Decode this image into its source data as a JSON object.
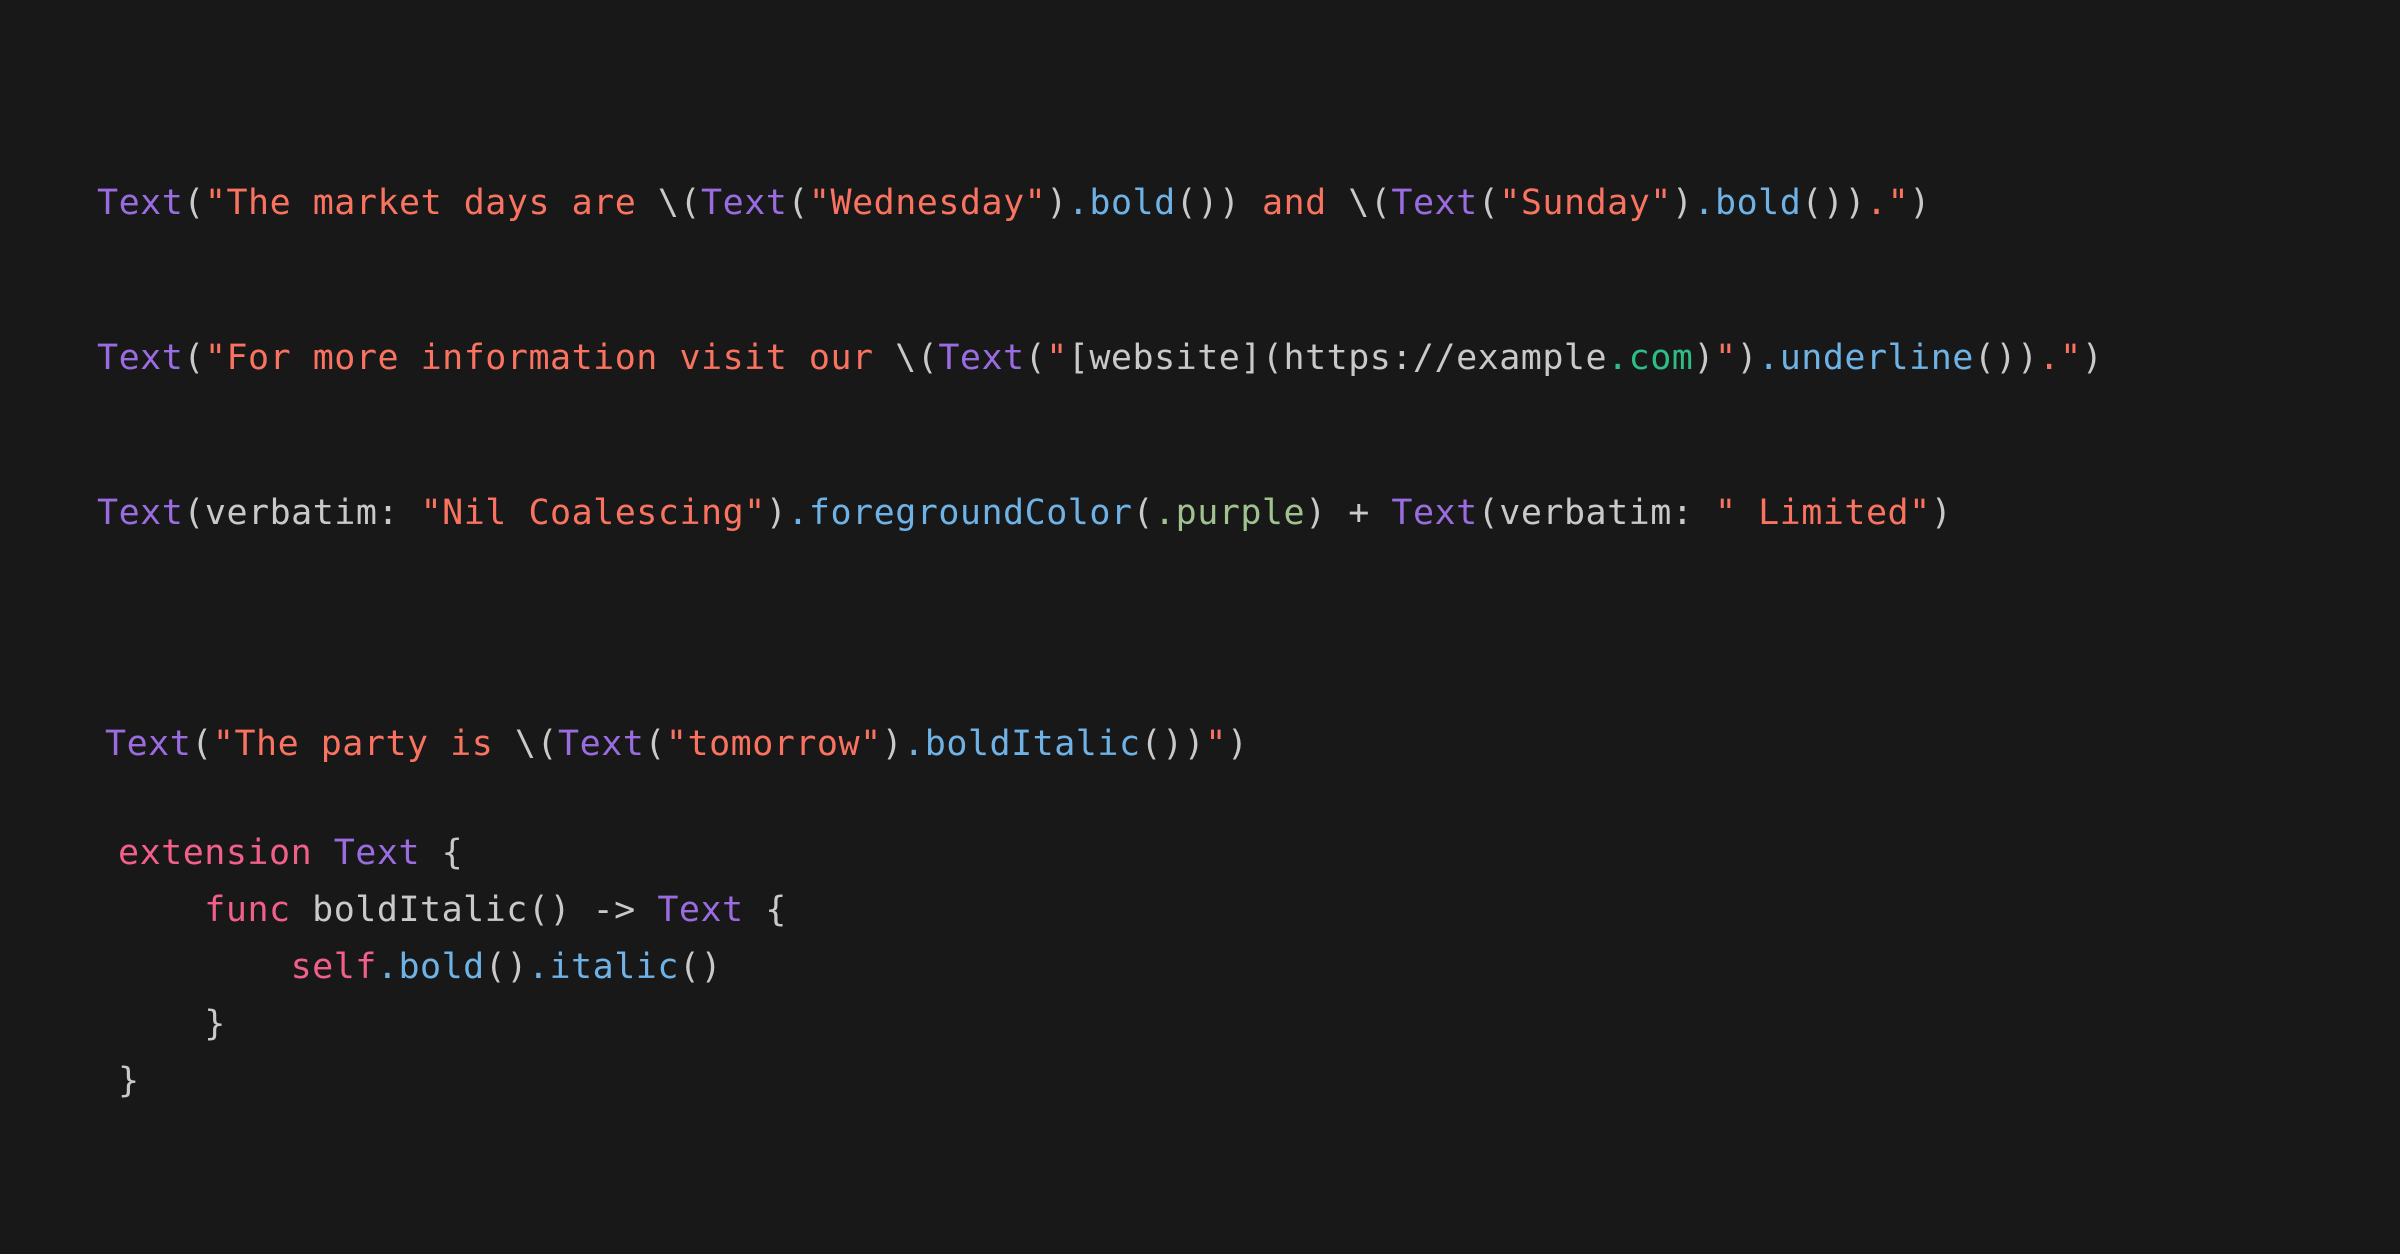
{
  "theme": {
    "background": "#181818",
    "plain": "#c9c9c9",
    "type": "#9a6ce0",
    "string": "#fa7360",
    "method": "#6fb2e6",
    "keyword": "#f2608a",
    "enum_case": "#a0c28f",
    "link_domain": "#2ebd84"
  },
  "language": "swift",
  "snippets": [
    {
      "id": "market-days",
      "text": "Text(\"The market days are \\(Text(\"Wednesday\").bold()) and \\(Text(\"Sunday\").bold()).\")",
      "tokens": [
        {
          "t": "Text",
          "c": "type"
        },
        {
          "t": "(",
          "c": "punct"
        },
        {
          "t": "\"The market days are ",
          "c": "string"
        },
        {
          "t": "\\(",
          "c": "plain"
        },
        {
          "t": "Text",
          "c": "type"
        },
        {
          "t": "(",
          "c": "punct"
        },
        {
          "t": "\"Wednesday\"",
          "c": "string"
        },
        {
          "t": ")",
          "c": "punct"
        },
        {
          "t": ".",
          "c": "method"
        },
        {
          "t": "bold",
          "c": "method"
        },
        {
          "t": "())",
          "c": "punct"
        },
        {
          "t": " and ",
          "c": "string"
        },
        {
          "t": "\\(",
          "c": "plain"
        },
        {
          "t": "Text",
          "c": "type"
        },
        {
          "t": "(",
          "c": "punct"
        },
        {
          "t": "\"Sunday\"",
          "c": "string"
        },
        {
          "t": ")",
          "c": "punct"
        },
        {
          "t": ".",
          "c": "method"
        },
        {
          "t": "bold",
          "c": "method"
        },
        {
          "t": "())",
          "c": "punct"
        },
        {
          "t": ".\"",
          "c": "string"
        },
        {
          "t": ")",
          "c": "punct"
        }
      ]
    },
    {
      "id": "website-link",
      "text": "Text(\"For more information visit our \\(Text(\"[website](https://example.com\").underline()).\")",
      "tokens": [
        {
          "t": "Text",
          "c": "type"
        },
        {
          "t": "(",
          "c": "punct"
        },
        {
          "t": "\"For more information visit our ",
          "c": "string"
        },
        {
          "t": "\\(",
          "c": "plain"
        },
        {
          "t": "Text",
          "c": "type"
        },
        {
          "t": "(",
          "c": "punct"
        },
        {
          "t": "\"",
          "c": "string"
        },
        {
          "t": "[website](https://example",
          "c": "plain"
        },
        {
          "t": ".com",
          "c": "link"
        },
        {
          "t": ")",
          "c": "plain"
        },
        {
          "t": "\"",
          "c": "string"
        },
        {
          "t": ")",
          "c": "punct"
        },
        {
          "t": ".",
          "c": "method"
        },
        {
          "t": "underline",
          "c": "method"
        },
        {
          "t": "())",
          "c": "punct"
        },
        {
          "t": ".\"",
          "c": "string"
        },
        {
          "t": ")",
          "c": "punct"
        }
      ]
    },
    {
      "id": "nil-coalescing",
      "text": "Text(verbatim: \"Nil Coalescing\").foregroundColor(.purple) + Text(verbatim: \" Limited\")",
      "tokens": [
        {
          "t": "Text",
          "c": "type"
        },
        {
          "t": "(",
          "c": "punct"
        },
        {
          "t": "verbatim: ",
          "c": "plain"
        },
        {
          "t": "\"Nil Coalescing\"",
          "c": "string"
        },
        {
          "t": ")",
          "c": "punct"
        },
        {
          "t": ".",
          "c": "method"
        },
        {
          "t": "foregroundColor",
          "c": "method"
        },
        {
          "t": "(",
          "c": "punct"
        },
        {
          "t": ".purple",
          "c": "enum"
        },
        {
          "t": ")",
          "c": "punct"
        },
        {
          "t": " + ",
          "c": "plain"
        },
        {
          "t": "Text",
          "c": "type"
        },
        {
          "t": "(",
          "c": "punct"
        },
        {
          "t": "verbatim: ",
          "c": "plain"
        },
        {
          "t": "\" Limited\"",
          "c": "string"
        },
        {
          "t": ")",
          "c": "punct"
        }
      ]
    },
    {
      "id": "party-tomorrow",
      "text": "Text(\"The party is \\(Text(\"tomorrow\").boldItalic())\")",
      "tokens": [
        {
          "t": "Text",
          "c": "type"
        },
        {
          "t": "(",
          "c": "punct"
        },
        {
          "t": "\"The party is ",
          "c": "string"
        },
        {
          "t": "\\(",
          "c": "plain"
        },
        {
          "t": "Text",
          "c": "type"
        },
        {
          "t": "(",
          "c": "punct"
        },
        {
          "t": "\"tomorrow\"",
          "c": "string"
        },
        {
          "t": ")",
          "c": "punct"
        },
        {
          "t": ".",
          "c": "method"
        },
        {
          "t": "boldItalic",
          "c": "method"
        },
        {
          "t": "())",
          "c": "punct"
        },
        {
          "t": "\"",
          "c": "string"
        },
        {
          "t": ")",
          "c": "punct"
        }
      ]
    },
    {
      "id": "extension-open",
      "text": "extension Text {",
      "tokens": [
        {
          "t": "extension",
          "c": "keyword"
        },
        {
          "t": " ",
          "c": "plain"
        },
        {
          "t": "Text",
          "c": "type"
        },
        {
          "t": " {",
          "c": "punct"
        }
      ]
    },
    {
      "id": "func-bolditalic",
      "text": "    func boldItalic() -> Text {",
      "tokens": [
        {
          "t": "    ",
          "c": "plain"
        },
        {
          "t": "func",
          "c": "keyword"
        },
        {
          "t": " boldItalic() -> ",
          "c": "plain"
        },
        {
          "t": "Text",
          "c": "type"
        },
        {
          "t": " {",
          "c": "punct"
        }
      ]
    },
    {
      "id": "self-bold-italic",
      "text": "        self.bold().italic()",
      "tokens": [
        {
          "t": "        ",
          "c": "plain"
        },
        {
          "t": "self",
          "c": "self"
        },
        {
          "t": ".",
          "c": "method"
        },
        {
          "t": "bold",
          "c": "method"
        },
        {
          "t": "()",
          "c": "punct"
        },
        {
          "t": ".",
          "c": "method"
        },
        {
          "t": "italic",
          "c": "method"
        },
        {
          "t": "()",
          "c": "punct"
        }
      ]
    },
    {
      "id": "func-close",
      "text": "    }",
      "tokens": [
        {
          "t": "    }",
          "c": "punct"
        }
      ]
    },
    {
      "id": "extension-close",
      "text": "}",
      "tokens": [
        {
          "t": "}",
          "c": "punct"
        }
      ]
    }
  ]
}
